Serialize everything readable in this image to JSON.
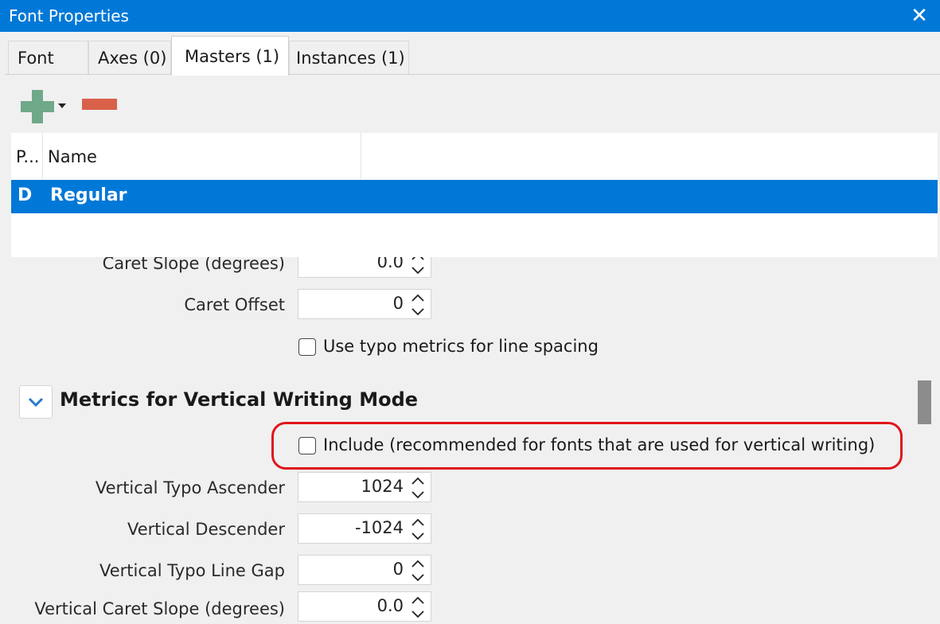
{
  "window": {
    "title": "Font Properties",
    "close_icon": "close-icon"
  },
  "tabs": [
    {
      "label": "Font",
      "active": false
    },
    {
      "label": "Axes (0)",
      "active": false
    },
    {
      "label": "Masters (1)",
      "active": true
    },
    {
      "label": "Instances (1)",
      "active": false
    }
  ],
  "toolbar": {
    "add_icon": "plus-icon",
    "add_menu_icon": "chevron-down-icon",
    "remove_icon": "minus-icon",
    "add_color": "#6fa98a",
    "remove_color": "#d9614a"
  },
  "masters_table": {
    "columns": [
      "P...",
      "Name"
    ],
    "rows": [
      {
        "p": "D",
        "name": "Regular",
        "selected": true
      }
    ]
  },
  "fields": {
    "caret_slope": {
      "label": "Caret Slope (degrees)",
      "value": "0.0"
    },
    "caret_offset": {
      "label": "Caret Offset",
      "value": "0"
    },
    "use_typo_metrics": {
      "label": "Use typo metrics for line spacing",
      "checked": false
    }
  },
  "vertical_section": {
    "title": "Metrics for Vertical Writing Mode",
    "expanded": true,
    "include": {
      "label": "Include (recommended for fonts that are used for vertical writing)",
      "checked": false
    },
    "fields": [
      {
        "label": "Vertical Typo Ascender",
        "value": "1024"
      },
      {
        "label": "Vertical Descender",
        "value": "-1024"
      },
      {
        "label": "Vertical Typo Line Gap",
        "value": "0"
      },
      {
        "label": "Vertical Caret Slope (degrees)",
        "value": "0.0"
      }
    ]
  },
  "colors": {
    "accent": "#0078d7",
    "highlight_ring": "#e0151a"
  }
}
